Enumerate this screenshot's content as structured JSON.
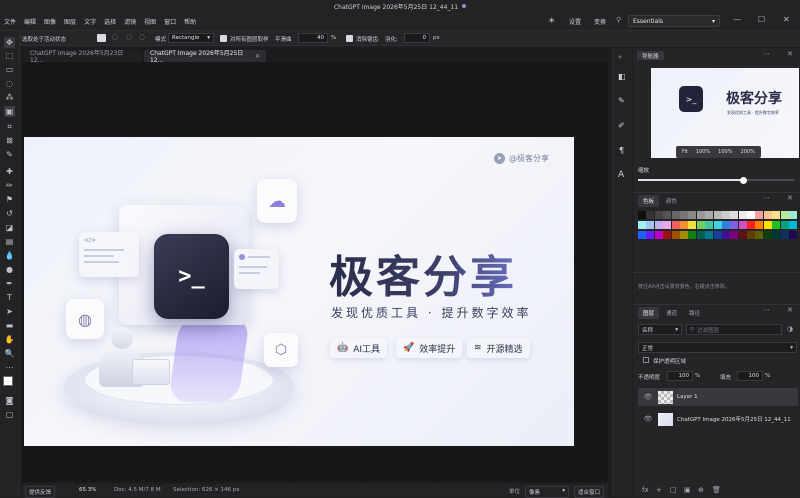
{
  "app": {
    "title": "ChatGPT Image 2026年5月25日 12_44_11"
  },
  "menu": {
    "items": [
      "文件",
      "编辑",
      "图像",
      "图层",
      "文字",
      "选择",
      "滤镜",
      "视图",
      "窗口",
      "帮助"
    ],
    "settings": "设置",
    "switch": "变换",
    "workspace": "Essentials"
  },
  "options": {
    "autoselect": "选取处于活动状态",
    "mode_label": "模式",
    "mode_value": "Rectangle",
    "sample_all": "对所有图层取样",
    "smooth_label": "平滑曲",
    "smooth_value": "40",
    "smooth_unit": "%",
    "antialias": "消除锯齿",
    "feather_label": "羽化:",
    "feather_value": "0",
    "feather_unit": "px"
  },
  "tabs": [
    {
      "label": "ChatGPT Image 2026年5月23日 12..."
    },
    {
      "label": "ChatGPT Image 2026年5月25日 12..."
    }
  ],
  "artwork": {
    "watermark": "@极客分享",
    "headline": "极客分享",
    "tagline": "发现优质工具 · 提升数字效率",
    "badges": [
      "AI工具",
      "效率提升",
      "开源精选"
    ],
    "terminal_prompt": ">_",
    "code_prompt": "</>"
  },
  "status": {
    "reset_label": "提供反馈",
    "zoom": "65.3%",
    "doc": "Doc: 4.5 M/7.8 M",
    "selection": "Selection: 626 × 146 px",
    "unit_label": "单位",
    "unit_value": "像素",
    "fit_label": "适合窗口"
  },
  "navigator": {
    "title": "导航器",
    "zoom_buttons": [
      "Fit",
      "100%",
      "100%",
      "200%"
    ],
    "zoom_label": "缩放",
    "zoom_level": 0.67,
    "preview_headline": "极客分享",
    "preview_tagline": "发现优质工具 · 提升数字效率"
  },
  "colors": {
    "tab_active": "色板",
    "tab_other": "颜色",
    "hint": "按住Alt点击设置背景色，右键点击移除。",
    "swatches_row1": [
      "#111111",
      "#333333",
      "#444444",
      "#555555",
      "#666666",
      "#777777",
      "#888888",
      "#999999",
      "#aaaaaa",
      "#bbbbbb",
      "#cccccc",
      "#dddddd",
      "#eeeeee",
      "#ffffff",
      "#f4a0a0",
      "#f8c490",
      "#f6e08a",
      "#b8e8a0",
      "#a0e8d0"
    ],
    "swatches_row2": [
      "#a0f0f0",
      "#a0c8f0",
      "#c0b0f0",
      "#e8a8e8",
      "#f06060",
      "#f09030",
      "#f0e040",
      "#70d060",
      "#40c8a0",
      "#40d0e0",
      "#3080e0",
      "#8060e0",
      "#d050c0",
      "#ff2020",
      "#ff8000",
      "#ffe000",
      "#20c020",
      "#00a080",
      "#00b8d8"
    ],
    "swatches_row3": [
      "#2060ff",
      "#6020ff",
      "#c000c0",
      "#a01010",
      "#a05000",
      "#a09000",
      "#108010",
      "#006050",
      "#007890",
      "#1040a0",
      "#401090",
      "#800080",
      "#601010",
      "#604000",
      "#606000",
      "#104010",
      "#003838",
      "#103060",
      "#200850"
    ]
  },
  "layers": {
    "tabs": [
      "图层",
      "通道",
      "路径"
    ],
    "filter_label": "名称",
    "filter_placeholder": "过滤图层",
    "blend_mode": "正常",
    "preserve_label": "保护透明区域",
    "opacity_label": "不透明度",
    "opacity_value": "100",
    "fill_label": "填充",
    "fill_value": "100",
    "percent": "%",
    "items": [
      {
        "name": "Layer 1"
      },
      {
        "name": "ChatGPT Image 2026年5月25日 12_44_11"
      }
    ]
  },
  "bottom_icons": [
    "fx",
    "+",
    "□",
    "▣",
    "⊕",
    "🗑"
  ]
}
